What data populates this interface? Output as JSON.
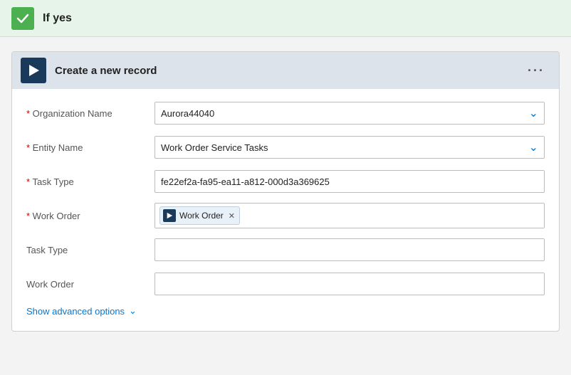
{
  "header": {
    "if_yes_label": "If yes",
    "check_icon": "checkmark-icon"
  },
  "card": {
    "title": "Create a new record",
    "menu_dots": "···",
    "header_icon": "play-icon",
    "fields": [
      {
        "label": "Organization Name",
        "required": true,
        "type": "dropdown",
        "value": "Aurora44040"
      },
      {
        "label": "Entity Name",
        "required": true,
        "type": "dropdown",
        "value": "Work Order Service Tasks"
      },
      {
        "label": "Task Type",
        "required": true,
        "type": "text",
        "value": "fe22ef2a-fa95-ea11-a812-000d3a369625"
      },
      {
        "label": "Work Order",
        "required": true,
        "type": "tag",
        "tag_text": "Work Order",
        "tag_icon": "play-icon"
      },
      {
        "label": "Task Type",
        "required": false,
        "type": "empty",
        "value": ""
      },
      {
        "label": "Work Order",
        "required": false,
        "type": "empty",
        "value": ""
      }
    ],
    "advanced_options_label": "Show advanced options"
  }
}
